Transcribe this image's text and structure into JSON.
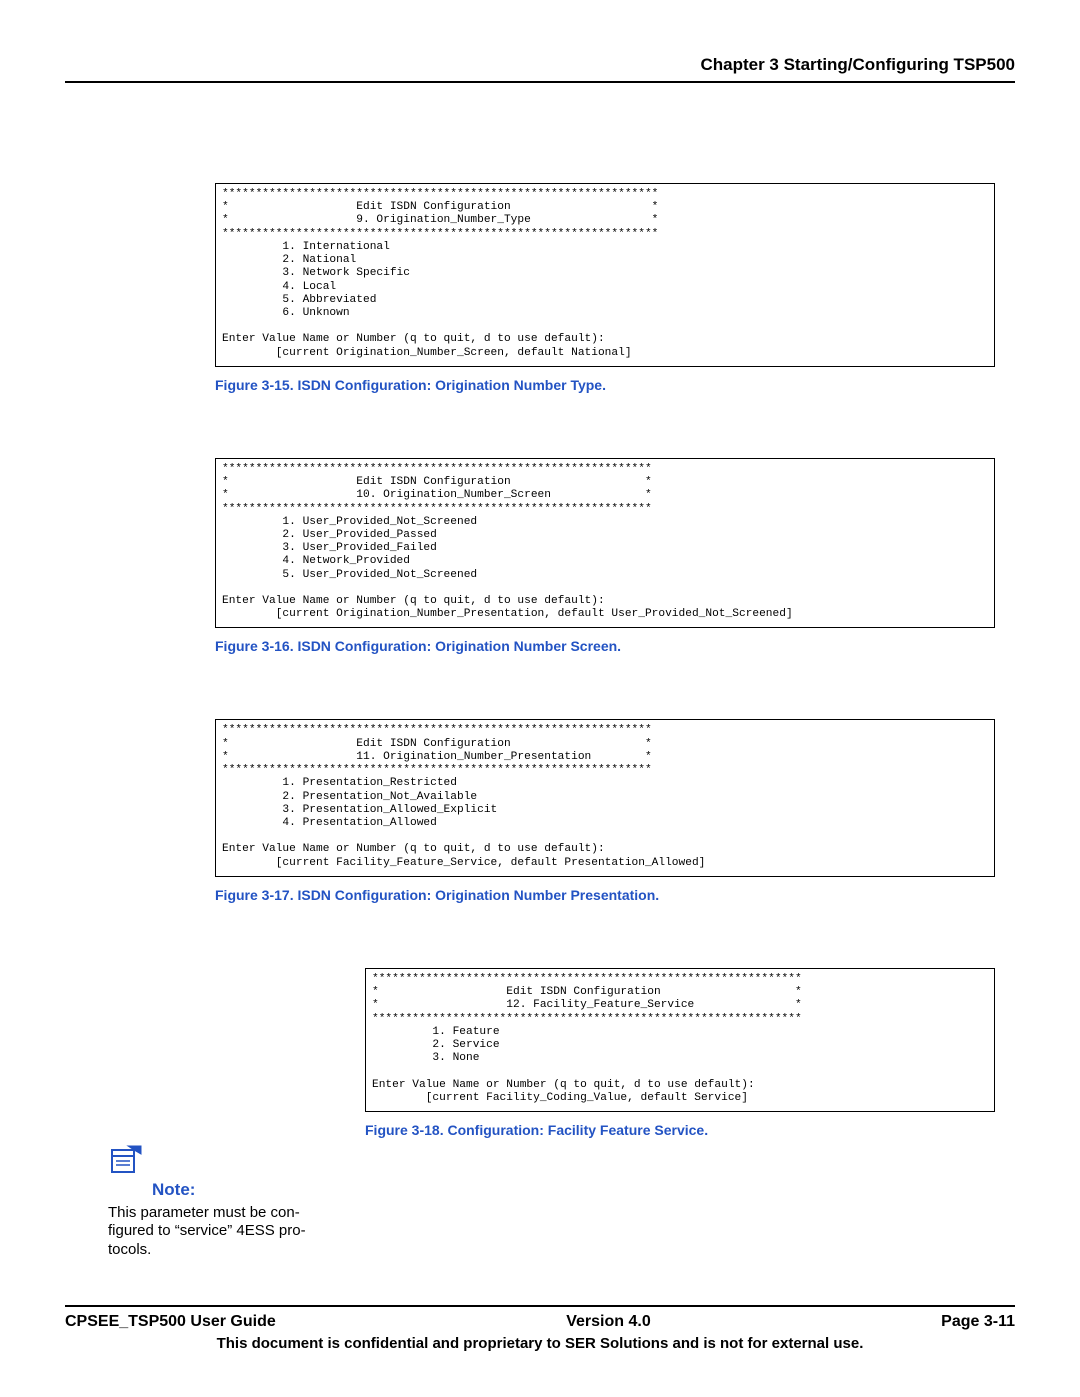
{
  "chapter_title": "Chapter 3 Starting/Configuring TSP500",
  "figures": {
    "f15": {
      "caption": "Figure 3-15. ISDN Configuration: Origination Number Type.",
      "term": "*****************************************************************\n*                   Edit ISDN Configuration                     *\n*                   9. Origination_Number_Type                  *\n*****************************************************************\n         1. International\n         2. National\n         3. Network Specific\n         4. Local\n         5. Abbreviated\n         6. Unknown\n\nEnter Value Name or Number (q to quit, d to use default):\n        [current Origination_Number_Screen, default National]"
    },
    "f16": {
      "caption": "Figure 3-16. ISDN Configuration: Origination Number Screen.",
      "term": "****************************************************************\n*                   Edit ISDN Configuration                    *\n*                   10. Origination_Number_Screen              *\n****************************************************************\n         1. User_Provided_Not_Screened\n         2. User_Provided_Passed\n         3. User_Provided_Failed\n         4. Network_Provided\n         5. User_Provided_Not_Screened\n\nEnter Value Name or Number (q to quit, d to use default):\n        [current Origination_Number_Presentation, default User_Provided_Not_Screened]"
    },
    "f17": {
      "caption": "Figure 3-17. ISDN Configuration: Origination Number Presentation.",
      "term": "****************************************************************\n*                   Edit ISDN Configuration                    *\n*                   11. Origination_Number_Presentation        *\n****************************************************************\n         1. Presentation_Restricted\n         2. Presentation_Not_Available\n         3. Presentation_Allowed_Explicit\n         4. Presentation_Allowed\n\nEnter Value Name or Number (q to quit, d to use default):\n        [current Facility_Feature_Service, default Presentation_Allowed]"
    },
    "f18": {
      "caption": "Figure 3-18. Configuration: Facility Feature Service.",
      "term": "****************************************************************\n*                   Edit ISDN Configuration                    *\n*                   12. Facility_Feature_Service               *\n****************************************************************\n         1. Feature\n         2. Service\n         3. None\n\nEnter Value Name or Number (q to quit, d to use default):\n        [current Facility_Coding_Value, default Service]"
    }
  },
  "note": {
    "label": "Note:",
    "text": "This parameter must be con-\nfigured to “service” 4ESS pro-\ntocols."
  },
  "footer": {
    "left": "CPSEE_TSP500 User Guide",
    "center": "Version 4.0",
    "right": "Page 3-11",
    "line2": "This document is confidential and proprietary to SER Solutions and is not for external use."
  }
}
